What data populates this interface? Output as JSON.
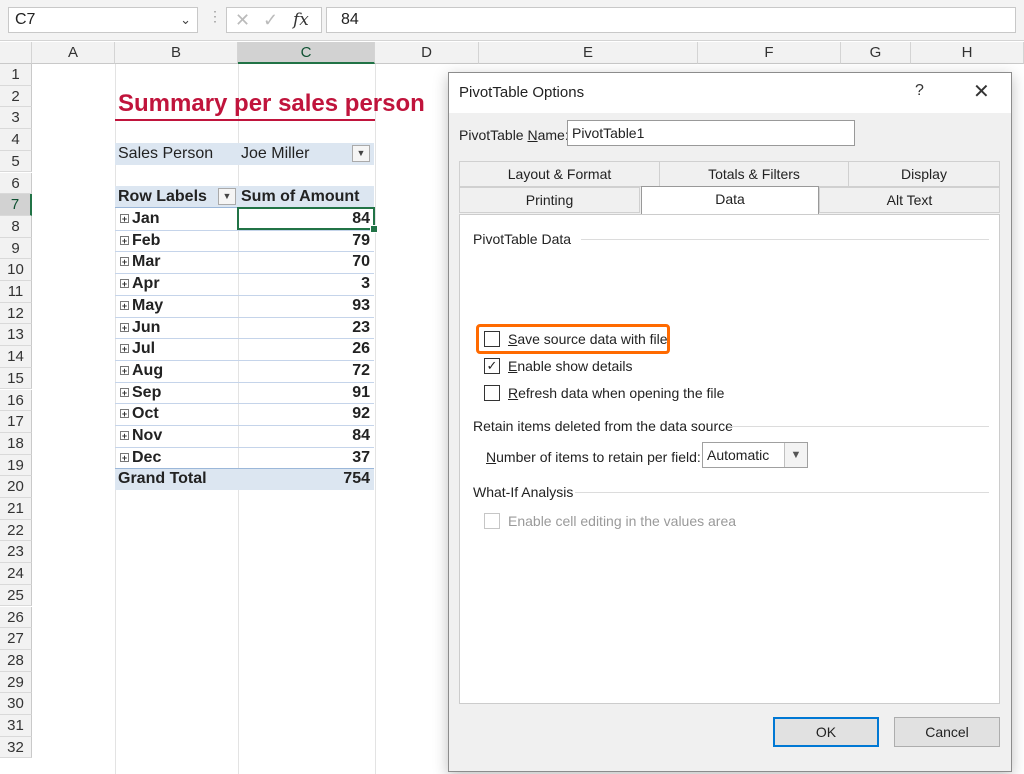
{
  "formula_bar": {
    "name_box": "C7",
    "fx": "fx",
    "cancel_glyph": "✕",
    "enter_glyph": "✓",
    "formula": "84"
  },
  "columns": [
    "A",
    "B",
    "C",
    "D",
    "E",
    "F",
    "G",
    "H"
  ],
  "rows": [
    "1",
    "2",
    "3",
    "4",
    "5",
    "6",
    "7",
    "8",
    "9",
    "10",
    "11",
    "12",
    "13",
    "14",
    "15",
    "16",
    "17",
    "18",
    "19",
    "20",
    "21",
    "22",
    "23",
    "24",
    "25",
    "26",
    "27",
    "28",
    "29",
    "30",
    "31",
    "32"
  ],
  "sheet": {
    "title": "Summary per sales person",
    "filter_label": "Sales Person",
    "filter_value": "Joe Miller",
    "row_labels_header": "Row Labels",
    "value_header": "Sum of Amount",
    "months": [
      {
        "label": "Jan",
        "value": "84"
      },
      {
        "label": "Feb",
        "value": "79"
      },
      {
        "label": "Mar",
        "value": "70"
      },
      {
        "label": "Apr",
        "value": "3"
      },
      {
        "label": "May",
        "value": "93"
      },
      {
        "label": "Jun",
        "value": "23"
      },
      {
        "label": "Jul",
        "value": "26"
      },
      {
        "label": "Aug",
        "value": "72"
      },
      {
        "label": "Sep",
        "value": "91"
      },
      {
        "label": "Oct",
        "value": "92"
      },
      {
        "label": "Nov",
        "value": "84"
      },
      {
        "label": "Dec",
        "value": "37"
      }
    ],
    "grand_total_label": "Grand Total",
    "grand_total_value": "754",
    "accent_color": "#c0143c",
    "pivot_fill": "#dce6f1"
  },
  "dialog": {
    "title": "PivotTable Options",
    "help": "?",
    "close": "✕",
    "name_label_pre": "PivotTable ",
    "name_label_u": "N",
    "name_label_post": "ame:",
    "name_value": "PivotTable1",
    "tabs_row1": [
      "Layout & Format",
      "Totals & Filters",
      "Display"
    ],
    "tabs_row2": [
      "Printing",
      "Data",
      "Alt Text"
    ],
    "active_tab": "Data",
    "group1": "PivotTable Data",
    "save_u": "S",
    "save_rest": "ave source data with file",
    "enable_u": "E",
    "enable_rest": "nable show details",
    "refresh_u": "R",
    "refresh_rest": "efresh data when opening the file",
    "group2": "Retain items deleted from the data source",
    "retain_u": "N",
    "retain_rest": "umber of items to retain per field:",
    "retain_value": "Automatic",
    "group3": "What-If Analysis",
    "whatif_label": "Enable cell editing in the values area",
    "ok": "OK",
    "cancel": "Cancel",
    "highlight_color": "#ff6a00"
  }
}
